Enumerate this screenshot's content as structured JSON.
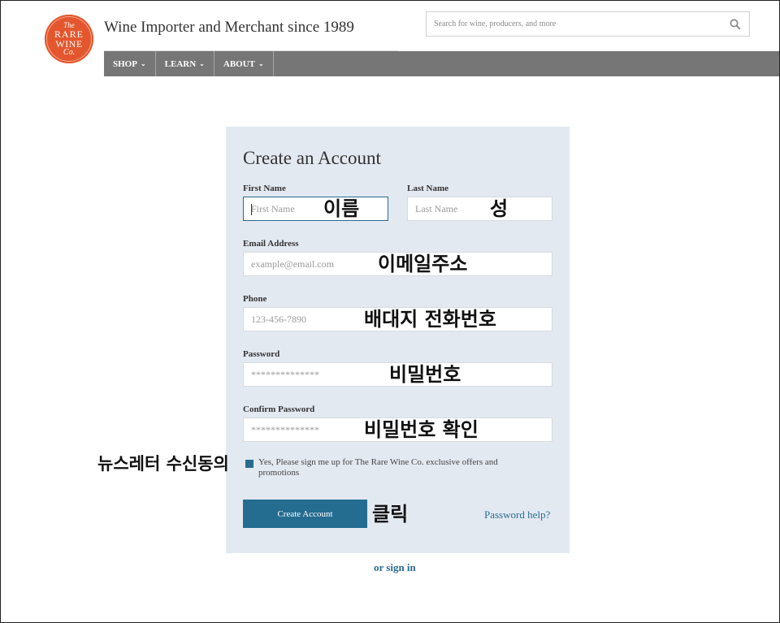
{
  "header": {
    "logo": {
      "line1": "The",
      "line2": "RARE",
      "line3": "WINE",
      "line4": "Co."
    },
    "tagline": "Wine Importer and Merchant since 1989",
    "search": {
      "placeholder": "Search for wine, producers, and more",
      "icon": "search-icon"
    }
  },
  "nav": {
    "items": [
      {
        "label": "SHOP",
        "icon": "chevron-down-icon"
      },
      {
        "label": "LEARN",
        "icon": "chevron-down-icon"
      },
      {
        "label": "ABOUT",
        "icon": "chevron-down-icon"
      }
    ],
    "chevron_glyph": "⌄"
  },
  "form": {
    "title": "Create an Account",
    "first_name": {
      "label": "First Name",
      "placeholder": "First Name"
    },
    "last_name": {
      "label": "Last Name",
      "placeholder": "Last Name"
    },
    "email": {
      "label": "Email Address",
      "placeholder": "example@email.com"
    },
    "phone": {
      "label": "Phone",
      "placeholder": "123-456-7890"
    },
    "password": {
      "label": "Password",
      "placeholder": "**************"
    },
    "confirm_password": {
      "label": "Confirm Password",
      "placeholder": "**************"
    },
    "newsletter": {
      "text": "Yes, Please sign me up for The Rare Wine Co. exclusive offers and promotions",
      "checked": true
    },
    "submit_label": "Create Account",
    "password_help": "Password help?"
  },
  "signin_link": "or sign in",
  "annotations": {
    "first_name": "이름",
    "last_name": "성",
    "email": "이메일주소",
    "phone": "배대지 전화번호",
    "password": "비밀번호",
    "confirm_password": "비밀번호 확인",
    "newsletter": "뉴스레터 수신동의",
    "submit": "클릭"
  },
  "colors": {
    "brand": "#e4572e",
    "nav_bg": "#767676",
    "panel_bg": "#e3e9f1",
    "button_bg": "#256c91",
    "link": "#2a6b8f"
  }
}
